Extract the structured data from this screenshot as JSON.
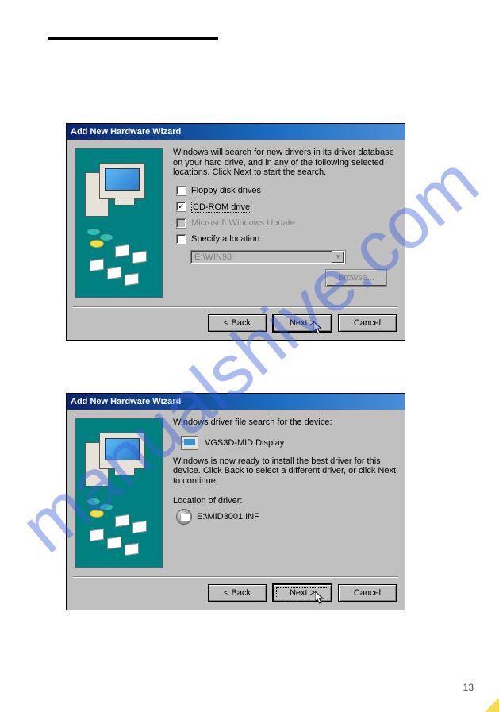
{
  "page": {
    "number": "13"
  },
  "watermark": "manualshive.com",
  "window1": {
    "title": "Add New Hardware Wizard",
    "message": "Windows will search for new drivers in its driver database on your hard drive, and in any of the following selected locations. Click Next to start the search.",
    "options": {
      "floppy": {
        "label": "Floppy disk drives",
        "checked": false
      },
      "cdrom": {
        "label": "CD-ROM drive",
        "checked": true,
        "focused": true
      },
      "update": {
        "label": "Microsoft Windows Update",
        "checked": false,
        "disabled": true
      },
      "specify": {
        "label": "Specify a location:",
        "checked": false
      }
    },
    "location_field": "E:\\WIN98",
    "buttons": {
      "browse": "Browse...",
      "back": "< Back",
      "next": "Next >",
      "cancel": "Cancel"
    }
  },
  "window2": {
    "title": "Add New Hardware Wizard",
    "search_msg": "Windows driver file search for the device:",
    "device_name": "VGS3D-MID Display",
    "ready_msg": "Windows is now ready to install the best driver for this device. Click Back to select a different driver, or click Next to continue.",
    "location_label": "Location of driver:",
    "driver_path": "E:\\MID3001.INF",
    "buttons": {
      "back": "< Back",
      "next": "Next >",
      "cancel": "Cancel"
    }
  }
}
